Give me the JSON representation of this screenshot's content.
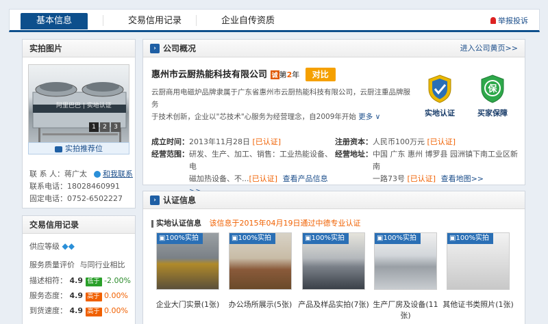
{
  "tabs": [
    {
      "label": "基本信息",
      "active": true
    },
    {
      "label": "交易信用记录",
      "active": false
    },
    {
      "label": "企业自传资质",
      "active": false
    }
  ],
  "report_label": "举报投诉",
  "left_photo": {
    "title": "实拍图片",
    "pager": [
      "1",
      "2",
      "3"
    ],
    "watermark": "阿里巴巴 | 实地认证",
    "store_btn": "实拍推荐位"
  },
  "contact": {
    "person_label": "联 系 人：",
    "person": "蒋广太",
    "chat": "和我联系",
    "phone_label": "联系电话：",
    "phone": "18028460991",
    "tel_label": "固定电话：",
    "tel": "0752-6502227"
  },
  "trade_credit": {
    "title": "交易信用记录",
    "level_label": "供应等级",
    "service_label": "服务质量评价",
    "compare_label": "与同行业相比",
    "rows": [
      {
        "label": "描述相符：",
        "score": "4.9",
        "badge": "低于",
        "pct": "-2.00%",
        "badge_color": "#2aa02a",
        "pct_color": "#2a8a2a"
      },
      {
        "label": "服务态度：",
        "score": "4.9",
        "badge": "高于",
        "pct": "0.00%",
        "badge_color": "#f06000",
        "pct_color": "#f06000"
      },
      {
        "label": "到货速度：",
        "score": "4.9",
        "badge": "高于",
        "pct": "0.00%",
        "badge_color": "#f06000",
        "pct_color": "#f06000"
      }
    ]
  },
  "overview": {
    "title": "公司概况",
    "link": "进入公司黄页>>",
    "company": "惠州市云厨热能科技有限公司",
    "year_badge": "诚",
    "year_prefix": "第",
    "year_num": "2",
    "year_suffix": "年",
    "compare_btn": "对比",
    "desc_line1": "云厨商用电磁炉品牌隶属于广东省惠州市云厨热能科技有限公司，云厨注重品牌服务",
    "desc_line2": "于技术创新，企业以\"芯技术\"心服务为经营理念，自2009年开始",
    "more": "更多",
    "badge1": "实地认证",
    "badge2": "买家保障",
    "founded_label": "成立时间：",
    "founded": "2013年11月28日",
    "certified": "[已认证]",
    "capital_label": "注册资本：",
    "capital": "人民币100万元",
    "scope_label": "经营范围：",
    "scope_line1": "研发、生产、加工、销售：工业热能设备、电",
    "scope_line2": "磁加热设备、不...",
    "scope_link": "查看产品信息>>",
    "addr_label": "经营地址：",
    "addr_line1": "中国 广东 惠州 博罗县 园洲镇下南工业区新南",
    "addr_line2": "一路73号",
    "map_link": "查看地图>>"
  },
  "certification": {
    "title": "认证信息",
    "sub_label": "实地认证信息",
    "sub_desc": "该信息于2015年04月19日通过中德专业认证",
    "thumb_badge": "100%实拍",
    "items": [
      {
        "caption": "企业大门实景(1张)"
      },
      {
        "caption": "办公场所展示(5张)"
      },
      {
        "caption": "产品及样品实拍(7张)"
      },
      {
        "caption": "生产厂房及设备(11张)"
      },
      {
        "caption": "其他证书类照片(1张)"
      }
    ]
  },
  "colors": {
    "brand": "#0d4f8c",
    "accent": "#f06000",
    "link": "#1a4d8a"
  }
}
